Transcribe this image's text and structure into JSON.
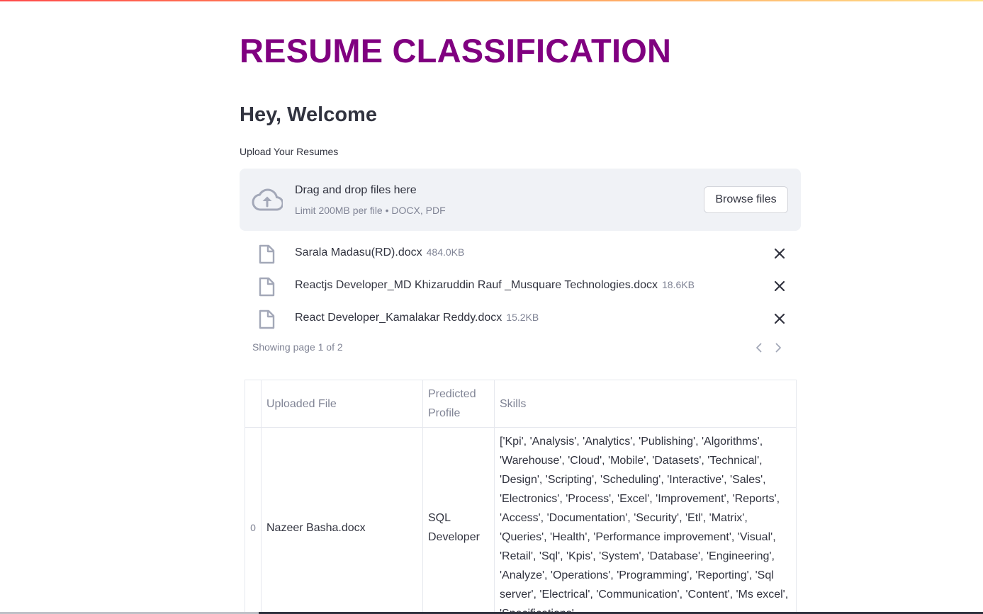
{
  "app": {
    "title": "RESUME CLASSIFICATION",
    "welcome": "Hey, Welcome"
  },
  "uploader": {
    "label": "Upload Your Resumes",
    "drop_text": "Drag and drop files here",
    "limit_text": "Limit 200MB per file • DOCX, PDF",
    "browse_label": "Browse files",
    "icon": "cloud-upload-icon",
    "files": [
      {
        "name": "Sarala Madasu(RD).docx",
        "size": "484.0KB"
      },
      {
        "name": "Reactjs Developer_MD Khizaruddin Rauf _Musquare Technologies.docx",
        "size": "18.6KB"
      },
      {
        "name": "React Developer_Kamalakar Reddy.docx",
        "size": "15.2KB"
      }
    ],
    "pager": "Showing page 1 of 2"
  },
  "table": {
    "columns": [
      "",
      "Uploaded File",
      "Predicted Profile",
      "Skills"
    ],
    "rows": [
      {
        "index": "0",
        "file": "Nazeer Basha.docx",
        "profile": "SQL Developer",
        "skills": "['Kpi', 'Analysis', 'Analytics', 'Publishing', 'Algorithms', 'Warehouse', 'Cloud', 'Mobile', 'Datasets', 'Technical', 'Design', 'Scripting', 'Scheduling', 'Interactive', 'Sales', 'Electronics', 'Process', 'Excel', 'Improvement', 'Reports', 'Access', 'Documentation', 'Security', 'Etl', 'Matrix', 'Queries', 'Health', 'Performance improvement', 'Visual', 'Retail', 'Sql', 'Kpis', 'System', 'Database', 'Engineering', 'Analyze', 'Operations', 'Programming', 'Reporting', 'Sql server', 'Electrical', 'Communication', 'Content', 'Ms excel', 'Specifications'"
      }
    ]
  },
  "colors": {
    "title": "#800080",
    "text": "#31333f",
    "muted": "#808495",
    "dropzone_bg": "#f0f2f6"
  }
}
